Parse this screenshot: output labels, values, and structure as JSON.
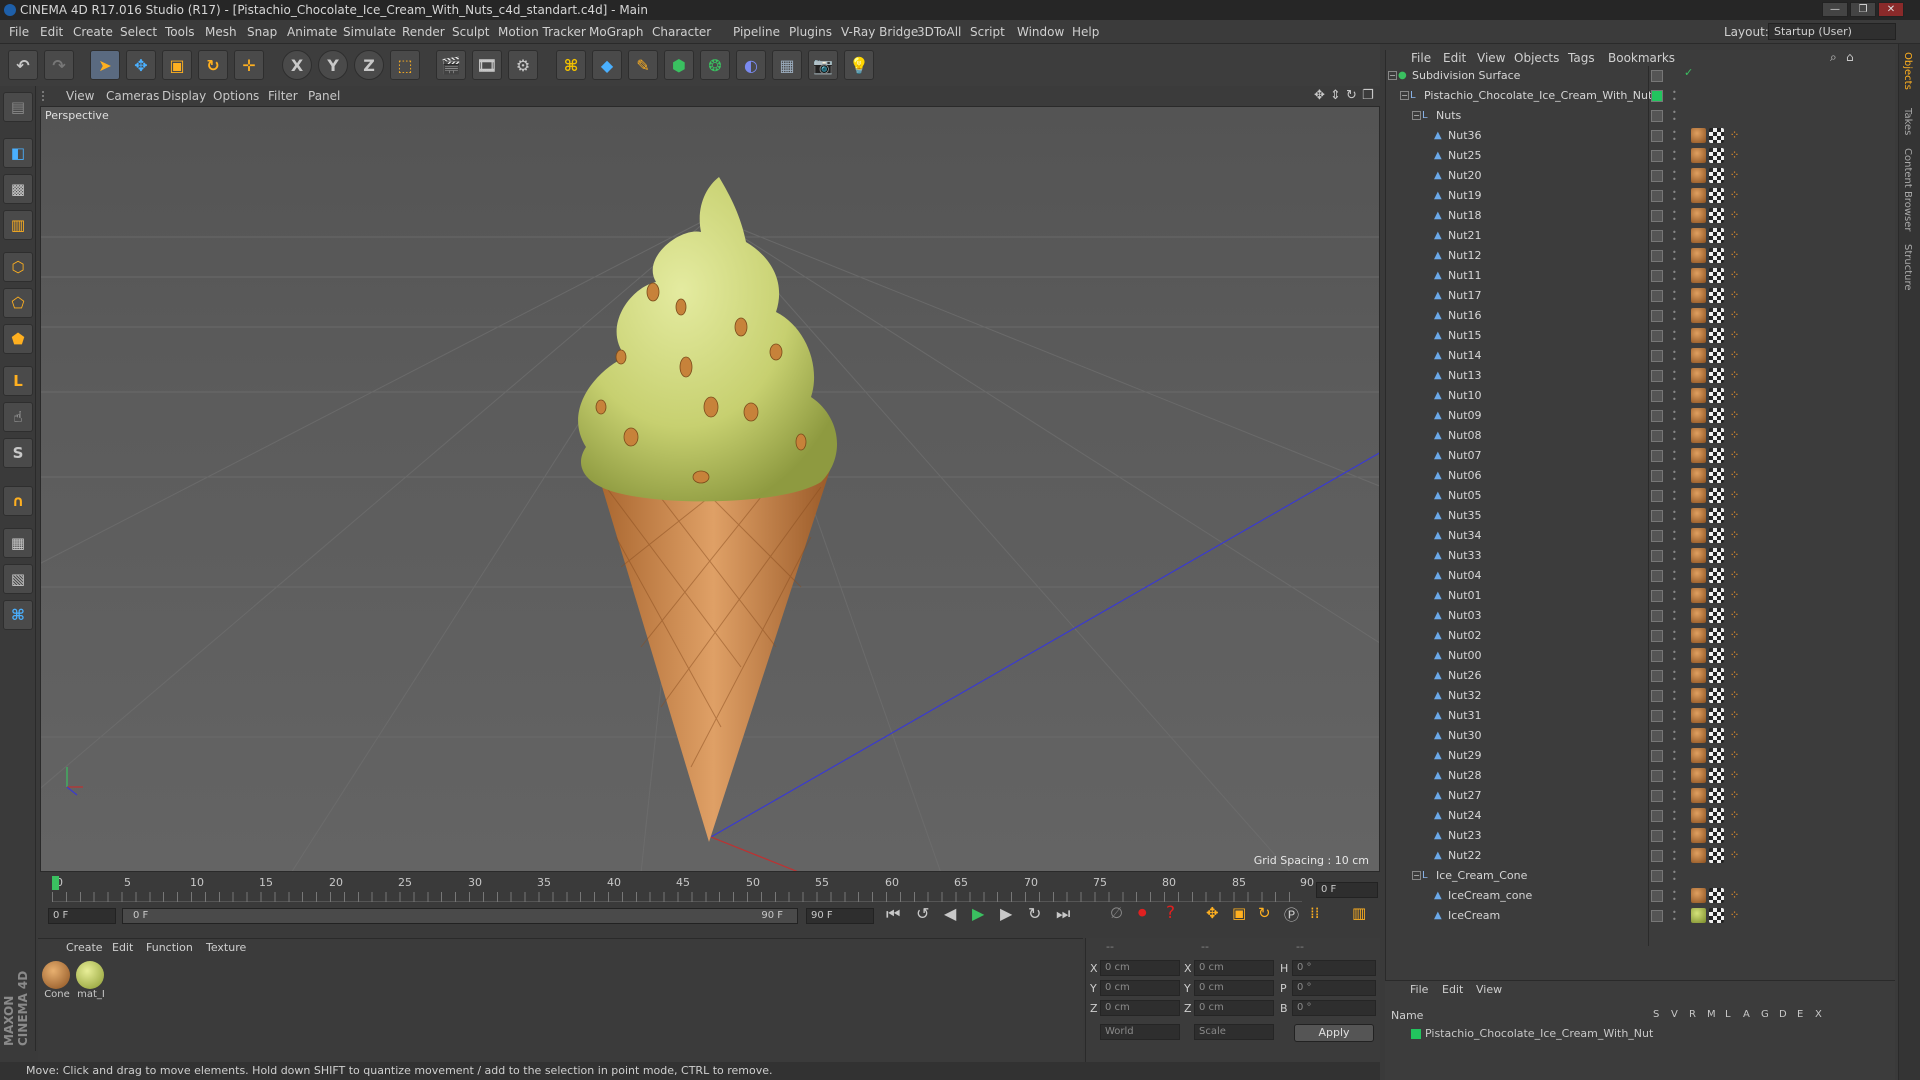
{
  "window": {
    "title": "CINEMA 4D R17.016 Studio (R17) - [Pistachio_Chocolate_Ice_Cream_With_Nuts_c4d_standart.c4d] - Main",
    "layout_label": "Layout:",
    "layout_value": "Startup (User)"
  },
  "menu": [
    "File",
    "Edit",
    "Create",
    "Select",
    "Tools",
    "Mesh",
    "Snap",
    "Animate",
    "Simulate",
    "Render",
    "Sculpt",
    "Motion Tracker",
    "MoGraph",
    "Character",
    "Pipeline",
    "Plugins",
    "V-Ray Bridge",
    "3DToAll",
    "Script",
    "Window",
    "Help"
  ],
  "toolbar": {
    "axis_x": "X",
    "axis_y": "Y",
    "axis_z": "Z"
  },
  "viewport": {
    "menu": [
      "View",
      "Cameras",
      "Display",
      "Options",
      "Filter",
      "Panel"
    ],
    "camera_label": "Perspective",
    "grid_spacing": "Grid Spacing : 10 cm"
  },
  "timeline": {
    "ticks": [
      "0",
      "5",
      "10",
      "15",
      "20",
      "25",
      "30",
      "35",
      "40",
      "45",
      "50",
      "55",
      "60",
      "65",
      "70",
      "75",
      "80",
      "85",
      "90"
    ],
    "current_frame": "0 F",
    "start_frame": "0 F",
    "slider_start": "0 F",
    "slider_end": "90 F",
    "end_frame": "90 F"
  },
  "materials": {
    "menu": [
      "Create",
      "Edit",
      "Function",
      "Texture"
    ],
    "items": [
      {
        "label": "Cone"
      },
      {
        "label": "mat_I"
      }
    ]
  },
  "coords": {
    "header": [
      "--",
      "--",
      "--"
    ],
    "rows": [
      {
        "a": "X",
        "av": "0 cm",
        "b": "X",
        "bv": "0 cm",
        "c": "H",
        "cv": "0 °"
      },
      {
        "a": "Y",
        "av": "0 cm",
        "b": "Y",
        "bv": "0 cm",
        "c": "P",
        "cv": "0 °"
      },
      {
        "a": "Z",
        "av": "0 cm",
        "b": "Z",
        "bv": "0 cm",
        "c": "B",
        "cv": "0 °"
      }
    ],
    "world": "World",
    "scale": "Scale",
    "apply": "Apply"
  },
  "status": "Move: Click and drag to move elements. Hold down SHIFT to quantize movement / add to the selection in point mode, CTRL to remove.",
  "objects": {
    "menu": [
      "File",
      "Edit",
      "View",
      "Objects",
      "Tags",
      "Bookmarks"
    ],
    "tree": [
      {
        "name": "Subdivision Surface",
        "level": 0,
        "kind": "root"
      },
      {
        "name": "Pistachio_Chocolate_Ice_Cream_With_Nut",
        "level": 1,
        "kind": "null"
      },
      {
        "name": "Nuts",
        "level": 2,
        "kind": "null"
      },
      {
        "name": "Nut36",
        "level": 3,
        "kind": "nut"
      },
      {
        "name": "Nut25",
        "level": 3,
        "kind": "nut"
      },
      {
        "name": "Nut20",
        "level": 3,
        "kind": "nut"
      },
      {
        "name": "Nut19",
        "level": 3,
        "kind": "nut"
      },
      {
        "name": "Nut18",
        "level": 3,
        "kind": "nut"
      },
      {
        "name": "Nut21",
        "level": 3,
        "kind": "nut"
      },
      {
        "name": "Nut12",
        "level": 3,
        "kind": "nut"
      },
      {
        "name": "Nut11",
        "level": 3,
        "kind": "nut"
      },
      {
        "name": "Nut17",
        "level": 3,
        "kind": "nut"
      },
      {
        "name": "Nut16",
        "level": 3,
        "kind": "nut"
      },
      {
        "name": "Nut15",
        "level": 3,
        "kind": "nut"
      },
      {
        "name": "Nut14",
        "level": 3,
        "kind": "nut"
      },
      {
        "name": "Nut13",
        "level": 3,
        "kind": "nut"
      },
      {
        "name": "Nut10",
        "level": 3,
        "kind": "nut"
      },
      {
        "name": "Nut09",
        "level": 3,
        "kind": "nut"
      },
      {
        "name": "Nut08",
        "level": 3,
        "kind": "nut"
      },
      {
        "name": "Nut07",
        "level": 3,
        "kind": "nut"
      },
      {
        "name": "Nut06",
        "level": 3,
        "kind": "nut"
      },
      {
        "name": "Nut05",
        "level": 3,
        "kind": "nut"
      },
      {
        "name": "Nut35",
        "level": 3,
        "kind": "nut"
      },
      {
        "name": "Nut34",
        "level": 3,
        "kind": "nut"
      },
      {
        "name": "Nut33",
        "level": 3,
        "kind": "nut"
      },
      {
        "name": "Nut04",
        "level": 3,
        "kind": "nut"
      },
      {
        "name": "Nut01",
        "level": 3,
        "kind": "nut"
      },
      {
        "name": "Nut03",
        "level": 3,
        "kind": "nut"
      },
      {
        "name": "Nut02",
        "level": 3,
        "kind": "nut"
      },
      {
        "name": "Nut00",
        "level": 3,
        "kind": "nut"
      },
      {
        "name": "Nut26",
        "level": 3,
        "kind": "nut"
      },
      {
        "name": "Nut32",
        "level": 3,
        "kind": "nut"
      },
      {
        "name": "Nut31",
        "level": 3,
        "kind": "nut"
      },
      {
        "name": "Nut30",
        "level": 3,
        "kind": "nut"
      },
      {
        "name": "Nut29",
        "level": 3,
        "kind": "nut"
      },
      {
        "name": "Nut28",
        "level": 3,
        "kind": "nut"
      },
      {
        "name": "Nut27",
        "level": 3,
        "kind": "nut"
      },
      {
        "name": "Nut24",
        "level": 3,
        "kind": "nut"
      },
      {
        "name": "Nut23",
        "level": 3,
        "kind": "nut"
      },
      {
        "name": "Nut22",
        "level": 3,
        "kind": "nut"
      },
      {
        "name": "Ice_Cream_Cone",
        "level": 2,
        "kind": "null"
      },
      {
        "name": "IceCream_cone",
        "level": 3,
        "kind": "cone"
      },
      {
        "name": "IceCream",
        "level": 3,
        "kind": "cream"
      }
    ]
  },
  "layers": {
    "menu": [
      "File",
      "Edit",
      "View"
    ],
    "name_col": "Name",
    "cols": [
      "S",
      "V",
      "R",
      "M",
      "L",
      "A",
      "G",
      "D",
      "E",
      "X"
    ],
    "row": "Pistachio_Chocolate_Ice_Cream_With_Nut"
  },
  "side_tabs": [
    "Objects",
    "Takes",
    "Content Browser",
    "Structure"
  ],
  "brand": "MAXON CINEMA 4D",
  "colors": {
    "accent_green": "#22c55e",
    "nut_tag": "#c7823a",
    "cream": "#cdd67a",
    "cone": "#c8844a"
  }
}
